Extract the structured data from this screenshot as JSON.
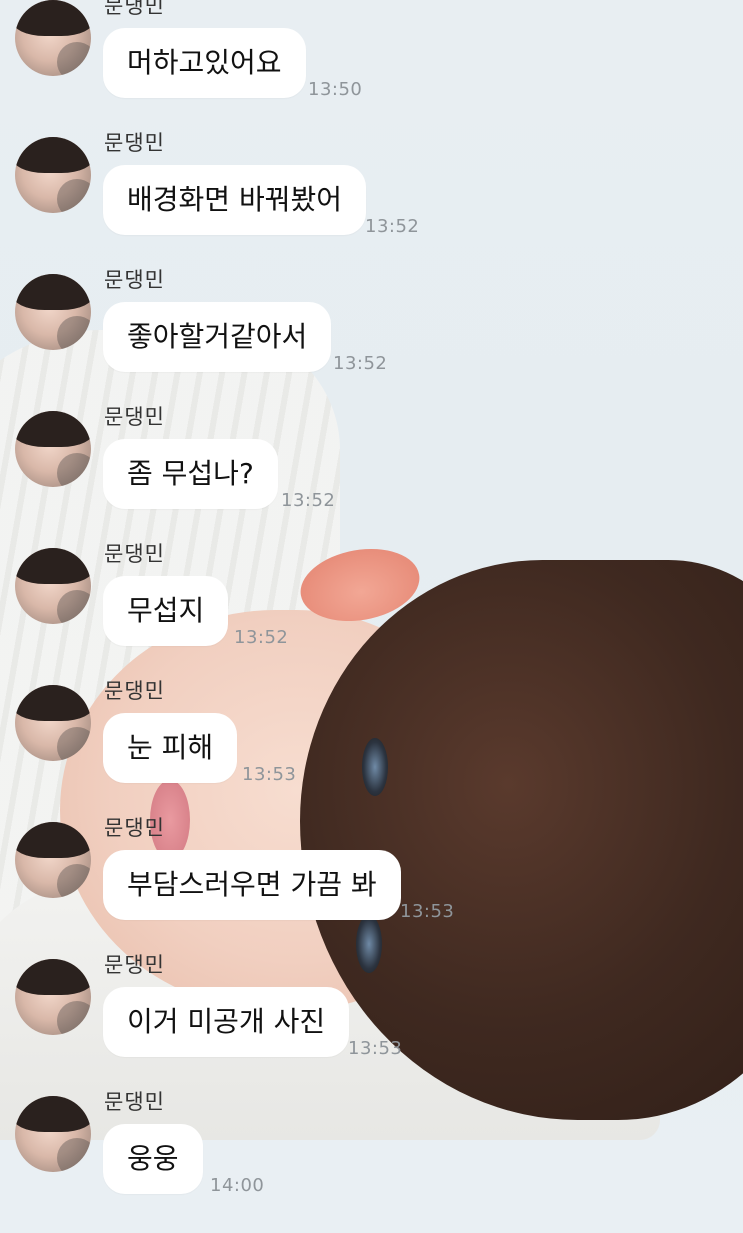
{
  "chat": {
    "sender_name": "문댕민",
    "messages": [
      {
        "text": "머하고있어요",
        "time": "13:50"
      },
      {
        "text": "배경화면 바꿔봤어",
        "time": "13:52"
      },
      {
        "text": "좋아할거같아서",
        "time": "13:52"
      },
      {
        "text": "좀 무섭나?",
        "time": "13:52"
      },
      {
        "text": "무섭지",
        "time": "13:52"
      },
      {
        "text": "눈 피해",
        "time": "13:53"
      },
      {
        "text": "부담스러우면 가끔 봐",
        "time": "13:53"
      },
      {
        "text": "이거 미공개 사진",
        "time": "13:53"
      },
      {
        "text": "웅웅",
        "time": "14:00"
      }
    ]
  },
  "theme": {
    "bubble_color": "#ffffff",
    "timestamp_color": "#8f959a",
    "background_color": "#e9eff3"
  }
}
